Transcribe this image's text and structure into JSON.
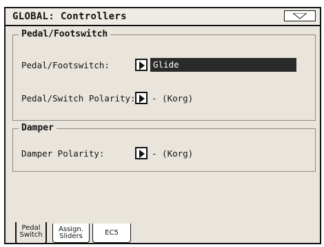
{
  "window": {
    "title": "GLOBAL: Controllers"
  },
  "groups": {
    "pedal": {
      "title": "Pedal/Footswitch",
      "rows": [
        {
          "label": "Pedal/Footswitch:",
          "value": "Glide"
        },
        {
          "label": "Pedal/Switch Polarity:",
          "value": "- (Korg)"
        }
      ]
    },
    "damper": {
      "title": "Damper",
      "rows": [
        {
          "label": "Damper Polarity:",
          "value": "- (Korg)"
        }
      ]
    }
  },
  "tabs": [
    {
      "line1": "Pedal",
      "line2": "Switch"
    },
    {
      "line1": "Assign.",
      "line2": "Sliders"
    },
    {
      "line1": "EC5",
      "line2": ""
    }
  ],
  "icons": {
    "menu": "triangle-down-icon",
    "arrow": "triangle-right-icon"
  }
}
